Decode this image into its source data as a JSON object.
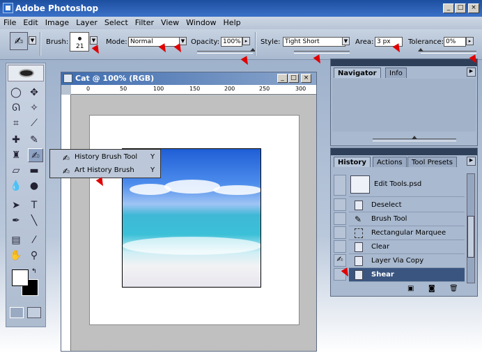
{
  "app": {
    "title": "Adobe Photoshop"
  },
  "menu": [
    "File",
    "Edit",
    "Image",
    "Layer",
    "Select",
    "Filter",
    "View",
    "Window",
    "Help"
  ],
  "options": {
    "brush_label": "Brush:",
    "brush_size": "21",
    "mode_label": "Mode:",
    "mode_value": "Normal",
    "opacity_label": "Opacity:",
    "opacity_value": "100%",
    "opacity_level": 1.0,
    "style_label": "Style:",
    "style_value": "Tight Short",
    "area_label": "Area:",
    "area_value": "3 px",
    "tolerance_label": "Tolerance:",
    "tolerance_value": "0%",
    "tolerance_level": 0.0
  },
  "document": {
    "title": "Cat @ 100% (RGB)",
    "ruler_h": [
      "0",
      "50",
      "100",
      "150",
      "200",
      "250",
      "300"
    ]
  },
  "flyout": {
    "items": [
      {
        "label": "History Brush Tool",
        "key": "Y"
      },
      {
        "label": "Art History Brush",
        "key": "Y"
      }
    ]
  },
  "navigator": {
    "tabs": [
      "Navigator",
      "Info"
    ]
  },
  "history": {
    "tabs": [
      "History",
      "Actions",
      "Tool Presets"
    ],
    "snapshot": "Edit Tools.psd",
    "items": [
      "Deselect",
      "Brush Tool",
      "Rectangular Marquee",
      "Clear",
      "Layer Via Copy",
      "Shear"
    ],
    "selected": "Shear"
  },
  "colors": {
    "titlebar": "#1d4fa0",
    "arrow": "#e00000",
    "selection": "#3a5680"
  }
}
